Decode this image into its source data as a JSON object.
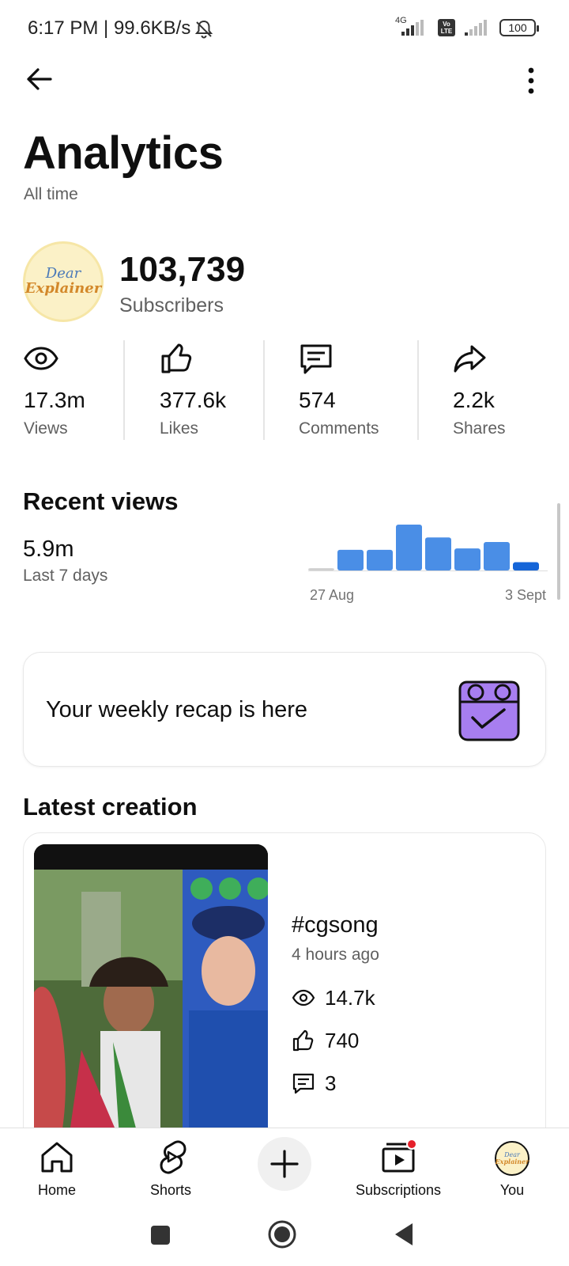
{
  "status_bar": {
    "time_speed": "6:17 PM | 99.6KB/s",
    "network_label": "4G",
    "volte_label": "Vo\nLTE",
    "battery": "100"
  },
  "page": {
    "title": "Analytics",
    "subtitle": "All time"
  },
  "channel": {
    "avatar_line1": "Dear",
    "avatar_line2": "Explainer",
    "subscriber_count": "103,739",
    "subscriber_label": "Subscribers"
  },
  "stats": [
    {
      "value": "17.3m",
      "label": "Views",
      "icon": "eye-icon"
    },
    {
      "value": "377.6k",
      "label": "Likes",
      "icon": "thumbs-up-icon"
    },
    {
      "value": "574",
      "label": "Comments",
      "icon": "comment-icon"
    },
    {
      "value": "2.2k",
      "label": "Shares",
      "icon": "share-icon"
    }
  ],
  "recent_views": {
    "title": "Recent views",
    "value": "5.9m",
    "period": "Last 7 days"
  },
  "chart_data": {
    "type": "bar",
    "title": "",
    "x_start_label": "27 Aug",
    "x_end_label": "3 Sept",
    "values": [
      0.05,
      0.45,
      0.45,
      1.0,
      0.72,
      0.48,
      0.62,
      0.18
    ],
    "colors": [
      "#cfcfcf",
      "#4a8ee6",
      "#4a8ee6",
      "#4a8ee6",
      "#4a8ee6",
      "#4a8ee6",
      "#4a8ee6",
      "#1565d8"
    ],
    "grid": false,
    "legend": "none"
  },
  "recap": {
    "text": "Your weekly recap is here"
  },
  "latest": {
    "section_title": "Latest creation",
    "video_title": "#cgsong",
    "posted": "4 hours ago",
    "views": "14.7k",
    "likes": "740",
    "comments": "3"
  },
  "bottom_nav": {
    "home": "Home",
    "shorts": "Shorts",
    "subscriptions": "Subscriptions",
    "you": "You"
  },
  "colors": {
    "accent_blue": "#4a8ee6",
    "notification_red": "#e5202a",
    "recap_purple": "#a77ef0"
  }
}
